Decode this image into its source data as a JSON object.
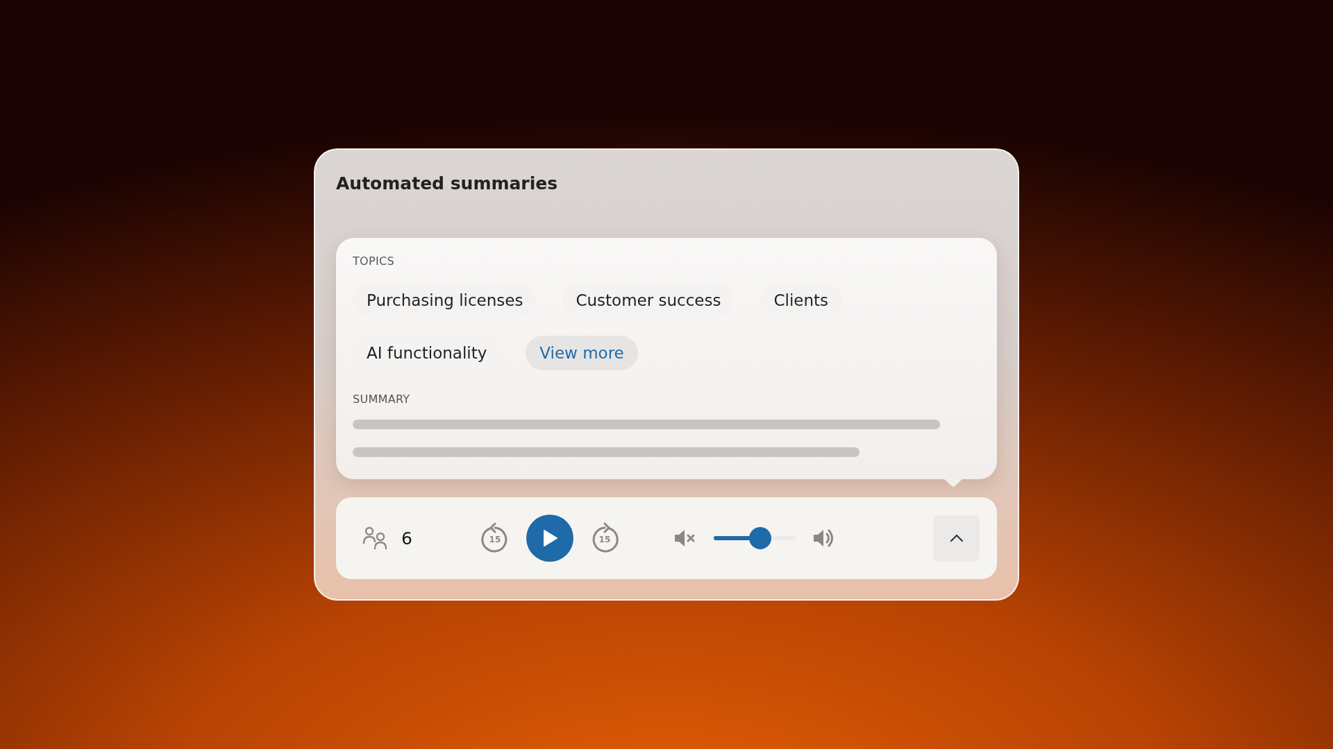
{
  "card": {
    "title": "Automated summaries"
  },
  "topics": {
    "label": "TOPICS",
    "items": [
      {
        "label": "Purchasing licenses"
      },
      {
        "label": "Customer success"
      },
      {
        "label": "Clients"
      },
      {
        "label": "AI functionality"
      }
    ],
    "more": "View more"
  },
  "summary": {
    "label": "SUMMARY"
  },
  "player": {
    "participants": "6",
    "rewind": "15",
    "forward": "15",
    "volume": {
      "level": 0.57
    }
  }
}
